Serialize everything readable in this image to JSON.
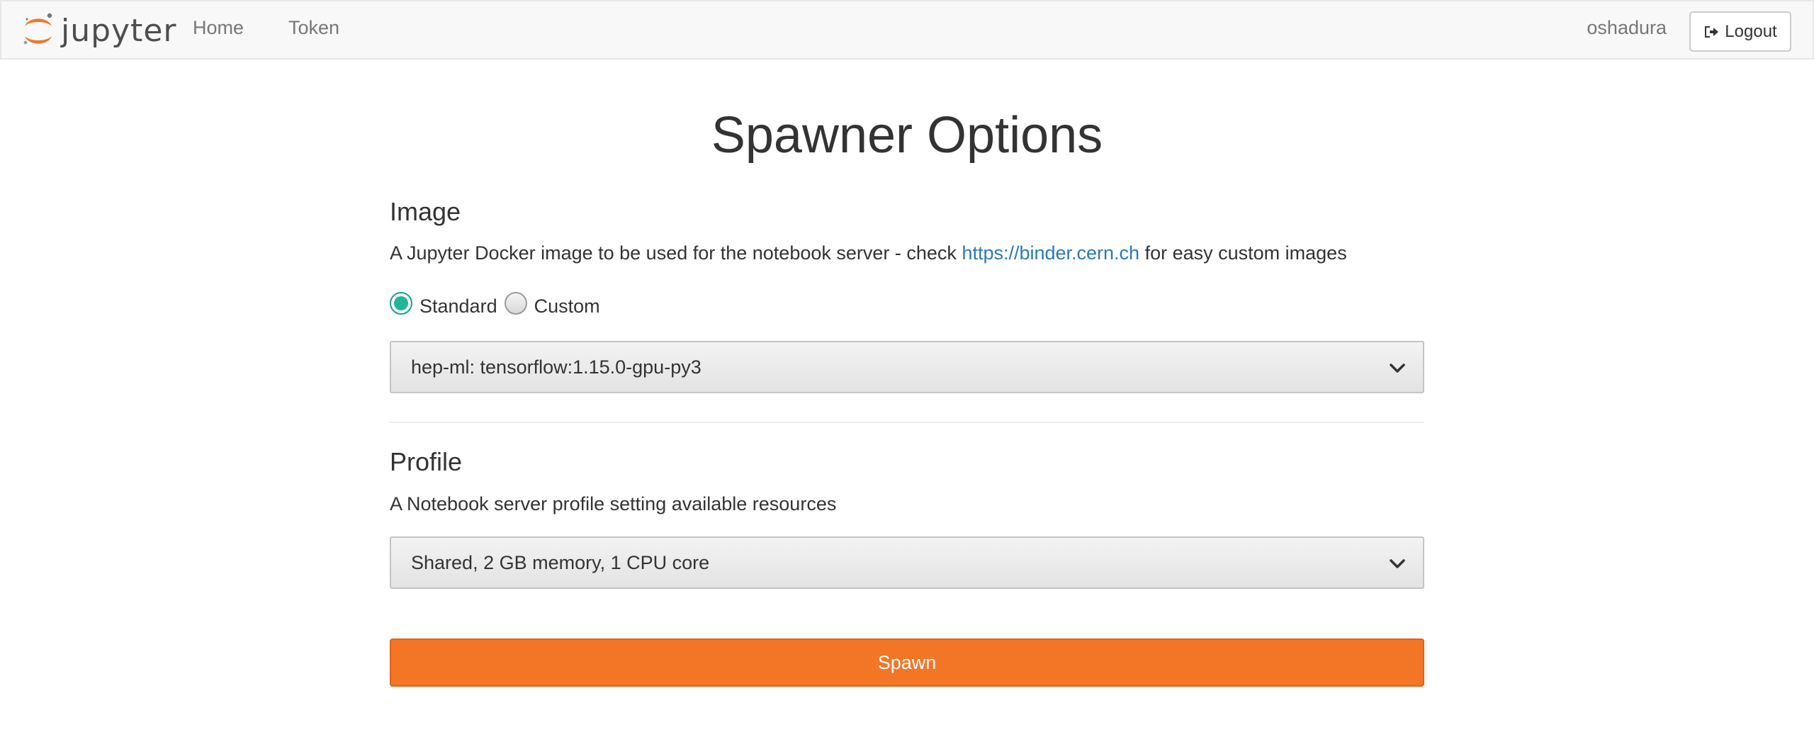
{
  "navbar": {
    "brand_text": "jupyter",
    "logo_icon": "jupyter-logo-icon",
    "links": [
      {
        "label": "Home"
      },
      {
        "label": "Token"
      }
    ],
    "username": "oshadura",
    "logout_label": "Logout",
    "logout_icon": "sign-out-icon"
  },
  "main": {
    "title": "Spawner Options",
    "image_section": {
      "heading": "Image",
      "desc_before": "A Jupyter Docker image to be used for the notebook server - check ",
      "desc_link": "https://binder.cern.ch",
      "desc_after": " for easy custom images",
      "radio_options": [
        {
          "label": "Standard",
          "checked": true
        },
        {
          "label": "Custom",
          "checked": false
        }
      ],
      "selected_image": "hep-ml: tensorflow:1.15.0-gpu-py3"
    },
    "profile_section": {
      "heading": "Profile",
      "description": "A Notebook server profile setting available resources",
      "selected_profile": "Shared, 2 GB memory, 1 CPU core"
    },
    "spawn_label": "Spawn"
  },
  "colors": {
    "accent": "#f37626",
    "link": "#2a7ab8",
    "radio_checked": "#20b598",
    "navbar_bg": "#f8f8f8"
  }
}
